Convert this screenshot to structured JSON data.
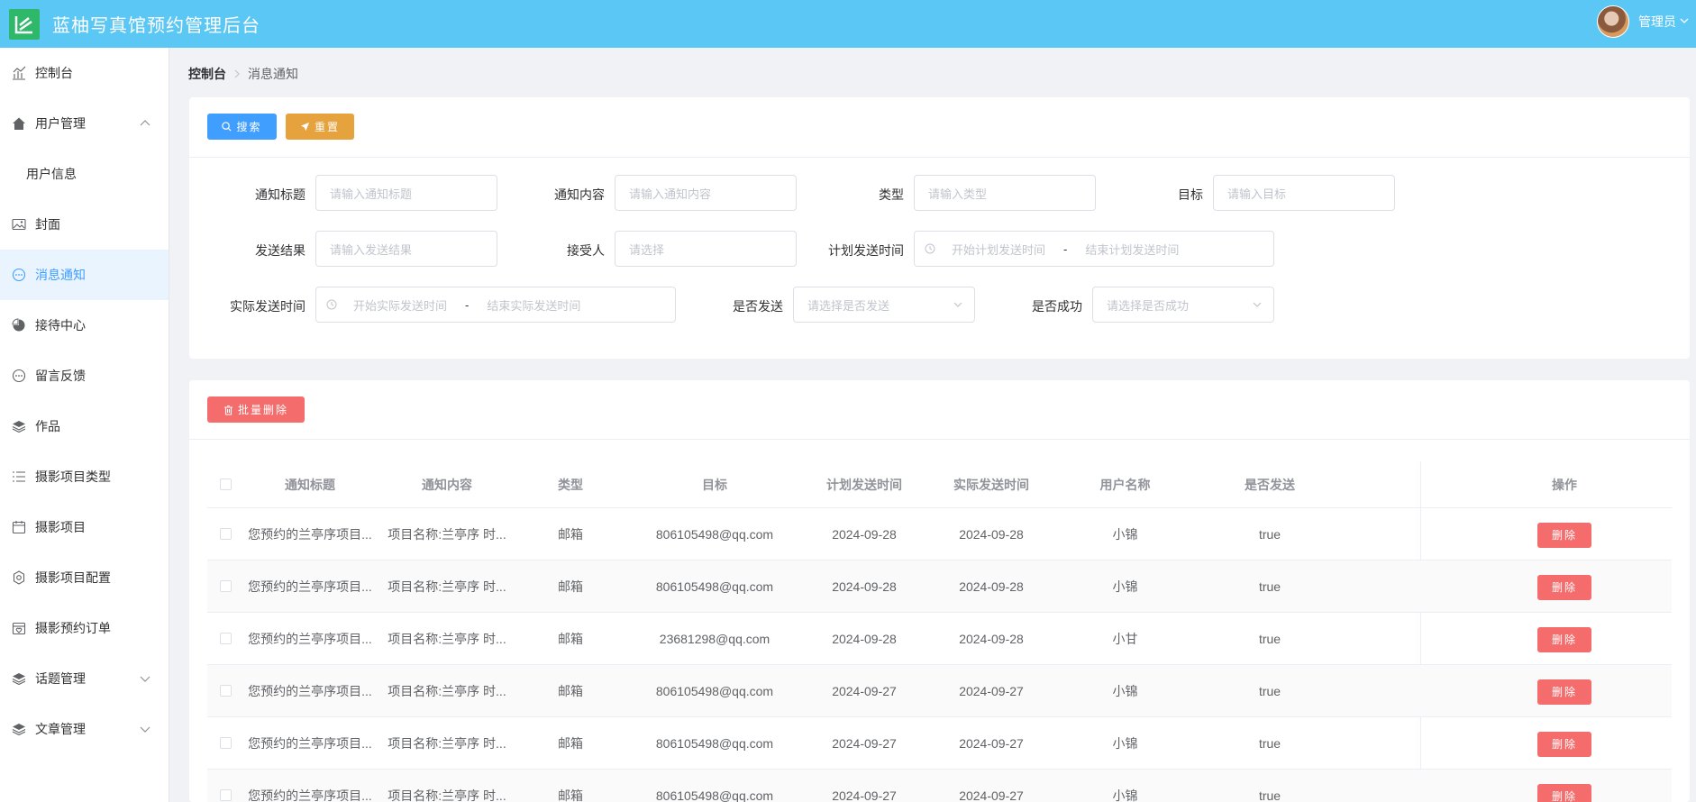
{
  "header": {
    "title": "蓝柚写真馆预约管理后台",
    "user": "管理员",
    "brand_color": "#5bc7f4"
  },
  "sidebar": {
    "items": [
      {
        "label": "控制台",
        "icon": "chart-icon"
      },
      {
        "label": "用户管理",
        "icon": "home-icon",
        "expanded": true,
        "children": [
          {
            "label": "用户信息"
          }
        ]
      },
      {
        "label": "封面",
        "icon": "image-icon"
      },
      {
        "label": "消息通知",
        "icon": "chat-icon",
        "active": true
      },
      {
        "label": "接待中心",
        "icon": "pie-icon"
      },
      {
        "label": "留言反馈",
        "icon": "chat-icon"
      },
      {
        "label": "作品",
        "icon": "layers-icon"
      },
      {
        "label": "摄影项目类型",
        "icon": "list-icon"
      },
      {
        "label": "摄影项目",
        "icon": "calendar-icon"
      },
      {
        "label": "摄影项目配置",
        "icon": "gear-icon"
      },
      {
        "label": "摄影预约订单",
        "icon": "heart-calendar-icon"
      },
      {
        "label": "话题管理",
        "icon": "layers-icon",
        "expanded": false
      },
      {
        "label": "文章管理",
        "icon": "layers-icon",
        "expanded": false
      }
    ]
  },
  "breadcrumb": {
    "home": "控制台",
    "current": "消息通知"
  },
  "toolbar": {
    "search_label": "搜索",
    "reset_label": "重置",
    "batch_delete_label": "批量删除"
  },
  "form": {
    "title": {
      "label": "通知标题",
      "placeholder": "请输入通知标题"
    },
    "content": {
      "label": "通知内容",
      "placeholder": "请输入通知内容"
    },
    "type": {
      "label": "类型",
      "placeholder": "请输入类型"
    },
    "target": {
      "label": "目标",
      "placeholder": "请输入目标"
    },
    "result": {
      "label": "发送结果",
      "placeholder": "请输入发送结果"
    },
    "receiver": {
      "label": "接受人",
      "placeholder": "请选择"
    },
    "plan_time": {
      "label": "计划发送时间",
      "start": "开始计划发送时间",
      "sep": "-",
      "end": "结束计划发送时间"
    },
    "actual_time": {
      "label": "实际发送时间",
      "start": "开始实际发送时间",
      "sep": "-",
      "end": "结束实际发送时间"
    },
    "is_sent": {
      "label": "是否发送",
      "placeholder": "请选择是否发送"
    },
    "is_success": {
      "label": "是否成功",
      "placeholder": "请选择是否成功"
    }
  },
  "table": {
    "columns": [
      "通知标题",
      "通知内容",
      "类型",
      "目标",
      "计划发送时间",
      "实际发送时间",
      "用户名称",
      "是否发送",
      "操作"
    ],
    "delete_label": "删除",
    "rows": [
      {
        "title": "您预约的兰亭序项目...",
        "content": "项目名称:兰亭序 时...",
        "type": "邮箱",
        "target": "806105498@qq.com",
        "plan": "2024-09-28",
        "actual": "2024-09-28",
        "user": "小锦",
        "sent": "true"
      },
      {
        "title": "您预约的兰亭序项目...",
        "content": "项目名称:兰亭序 时...",
        "type": "邮箱",
        "target": "806105498@qq.com",
        "plan": "2024-09-28",
        "actual": "2024-09-28",
        "user": "小锦",
        "sent": "true"
      },
      {
        "title": "您预约的兰亭序项目...",
        "content": "项目名称:兰亭序 时...",
        "type": "邮箱",
        "target": "23681298@qq.com",
        "plan": "2024-09-28",
        "actual": "2024-09-28",
        "user": "小甘",
        "sent": "true"
      },
      {
        "title": "您预约的兰亭序项目...",
        "content": "项目名称:兰亭序 时...",
        "type": "邮箱",
        "target": "806105498@qq.com",
        "plan": "2024-09-27",
        "actual": "2024-09-27",
        "user": "小锦",
        "sent": "true"
      },
      {
        "title": "您预约的兰亭序项目...",
        "content": "项目名称:兰亭序 时...",
        "type": "邮箱",
        "target": "806105498@qq.com",
        "plan": "2024-09-27",
        "actual": "2024-09-27",
        "user": "小锦",
        "sent": "true"
      },
      {
        "title": "您预约的兰亭序项目...",
        "content": "项目名称:兰亭序 时...",
        "type": "邮箱",
        "target": "806105498@qq.com",
        "plan": "2024-09-27",
        "actual": "2024-09-27",
        "user": "小锦",
        "sent": "true"
      }
    ]
  }
}
